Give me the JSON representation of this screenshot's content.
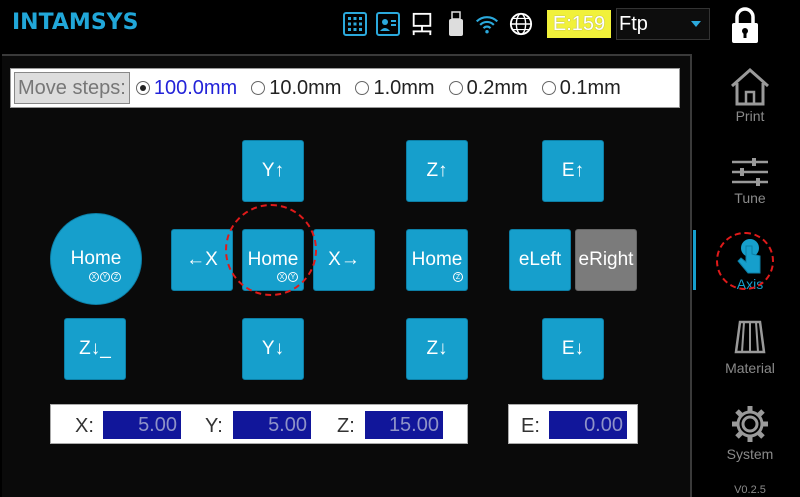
{
  "header": {
    "logo": "INTAMSYS",
    "extruder_badge": "E:159",
    "mode_select": "Ftp",
    "icons": [
      "keypad-icon",
      "user-card-icon",
      "network-lan-icon",
      "usb-drive-icon",
      "wifi-icon",
      "globe-icon",
      "lock-icon"
    ]
  },
  "move_steps": {
    "label": "Move steps:",
    "options": [
      "100.0mm",
      "10.0mm",
      "1.0mm",
      "0.2mm",
      "0.1mm"
    ],
    "selected": "100.0mm"
  },
  "controls": {
    "home_all": "Home",
    "home_all_sub": [
      "X",
      "Y",
      "Z"
    ],
    "z_down_left": "Z↓_",
    "y_up": "Y↑",
    "y_down": "Y↓",
    "x_left": "←X",
    "x_right": "X→",
    "home_xy": "Home",
    "home_xy_sub": [
      "X",
      "Y"
    ],
    "z_up": "Z↑",
    "z_down": "Z↓",
    "home_z": "Home",
    "home_z_sub": [
      "Z"
    ],
    "e_up": "E↑",
    "e_down": "E↓",
    "e_left": "eLeft",
    "e_right": "eRight"
  },
  "coords": {
    "x_label": "X:",
    "x_value": "5.00",
    "y_label": "Y:",
    "y_value": "5.00",
    "z_label": "Z:",
    "z_value": "15.00",
    "e_label": "E:",
    "e_value": "0.00"
  },
  "sidebar": {
    "items": [
      "Print",
      "Tune",
      "Axis",
      "Material",
      "System"
    ],
    "active": "Axis",
    "version": "V0.2.5"
  },
  "colors": {
    "accent": "#169fcc",
    "badge": "#f1f13a",
    "annotation": "#e01a1a"
  }
}
